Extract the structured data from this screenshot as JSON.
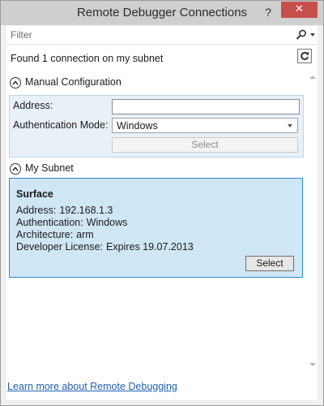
{
  "window": {
    "title": "Remote Debugger Connections",
    "help_label": "?",
    "close_label": "✕"
  },
  "filter": {
    "placeholder": "Filter",
    "value": "",
    "icon": "search-icon"
  },
  "status": {
    "found_text": "Found 1 connection on my subnet",
    "refresh_icon": "refresh-icon"
  },
  "manual_config": {
    "header": "Manual Configuration",
    "expanded": true,
    "address_label": "Address:",
    "address_value": "",
    "auth_mode_label": "Authentication Mode:",
    "auth_mode_value": "Windows",
    "select_label": "Select",
    "select_enabled": false
  },
  "subnet": {
    "header": "My Subnet",
    "expanded": true,
    "devices": [
      {
        "name": "Surface",
        "address_label": "Address:",
        "address": "192.168.1.3",
        "auth_label": "Authentication:",
        "auth": "Windows",
        "arch_label": "Architecture:",
        "arch": "arm",
        "license_label": "Developer License:",
        "license": "Expires 19.07.2013",
        "select_label": "Select",
        "selected": true
      }
    ]
  },
  "footer": {
    "learn_more": "Learn more about Remote Debugging"
  },
  "colors": {
    "accent": "#2e89c8",
    "selected_bg": "#cfe6f5",
    "close_bg": "#c7504c",
    "link": "#1f5fb0"
  }
}
